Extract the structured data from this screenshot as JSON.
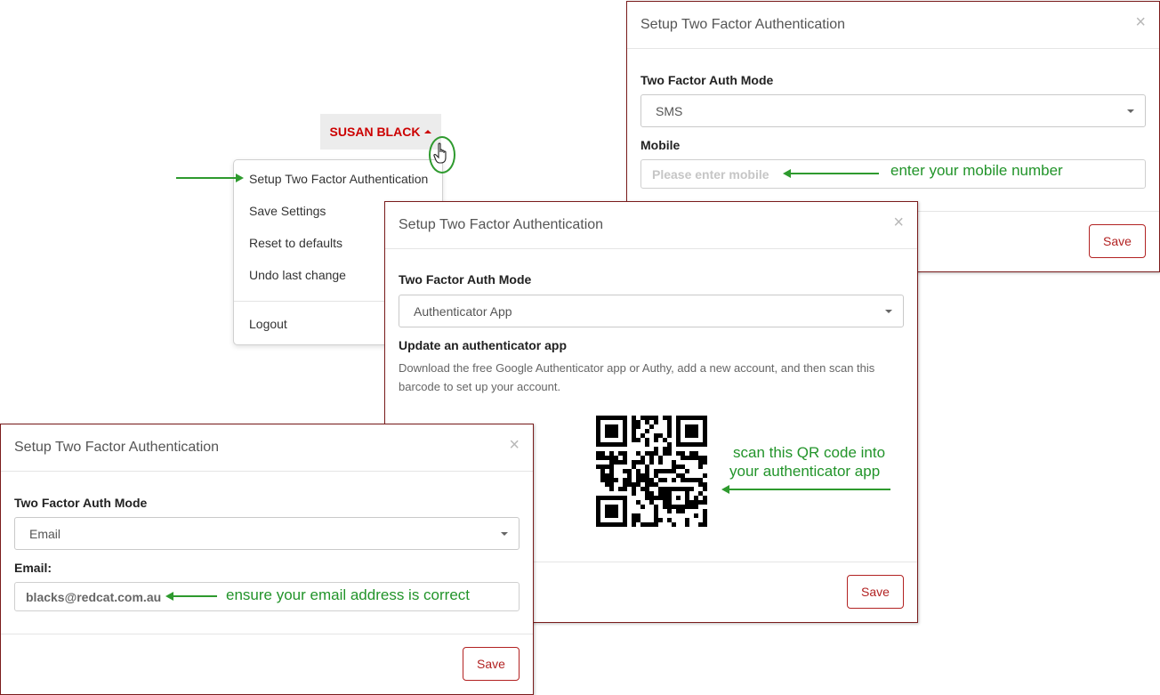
{
  "user_menu": {
    "name": "SUSAN BLACK",
    "items": [
      "Setup Two Factor Authentication",
      "Save Settings",
      "Reset to defaults",
      "Undo last change"
    ],
    "logout": "Logout"
  },
  "sms_modal": {
    "title": "Setup Two Factor Authentication",
    "close": "×",
    "mode_label": "Two Factor Auth Mode",
    "mode_value": "SMS",
    "mobile_label": "Mobile",
    "mobile_placeholder": "Please enter mobile",
    "annotation": "enter your mobile number",
    "save": "Save"
  },
  "app_modal": {
    "title": "Setup Two Factor Authentication",
    "close": "×",
    "mode_label": "Two Factor Auth Mode",
    "mode_value": "Authenticator App",
    "section_title": "Update an authenticator app",
    "description_line1": "Download the free Google Authenticator app or Authy, add a new account, and then scan this",
    "description_line2": "barcode to set up your account.",
    "annotation_line1": "scan this QR code into",
    "annotation_line2": "your authenticator app",
    "save": "Save"
  },
  "email_modal": {
    "title": "Setup Two Factor Authentication",
    "close": "×",
    "mode_label": "Two Factor Auth Mode",
    "mode_value": "Email",
    "email_label": "Email:",
    "email_value": "blacks@redcat.com.au",
    "annotation": "ensure your email address is correct",
    "save": "Save"
  },
  "colors": {
    "accent_red": "#cc0000",
    "annotation_green": "#2e9a2e",
    "modal_border": "#7a1c1c"
  }
}
